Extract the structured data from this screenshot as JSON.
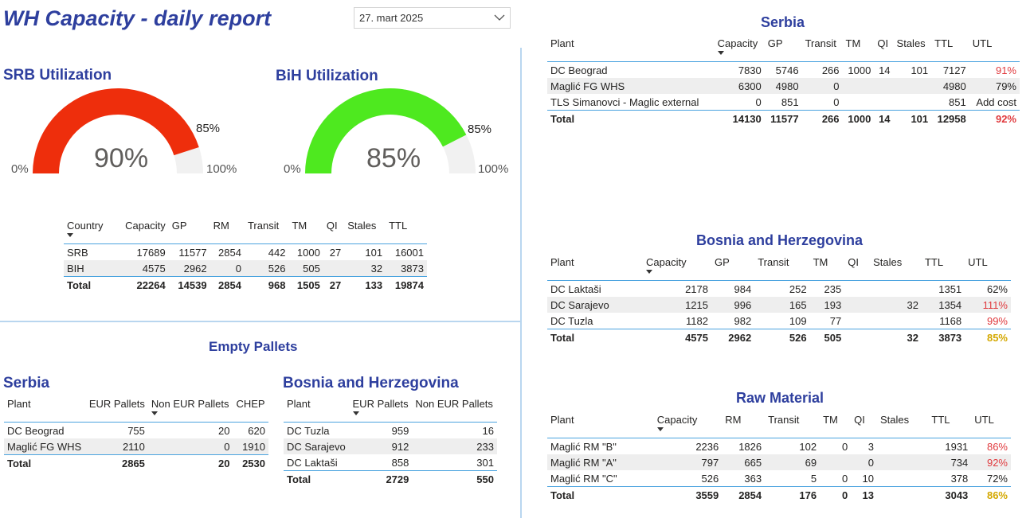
{
  "header": {
    "title": "WH Capacity - daily report",
    "date": "27. mart 2025"
  },
  "gauges": [
    {
      "title": "SRB Utilization",
      "value_label": "90%",
      "value": 0.9,
      "target_label": "85%",
      "target": 0.85,
      "min_label": "0%",
      "max_label": "100%",
      "color": "#ee2e0c"
    },
    {
      "title": "BiH Utilization",
      "value_label": "85%",
      "value": 0.85,
      "target_label": "85%",
      "target": 0.85,
      "min_label": "0%",
      "max_label": "100%",
      "color": "#4ee91f"
    }
  ],
  "country_table": {
    "columns": [
      "Country",
      "Capacity",
      "GP",
      "RM",
      "Transit",
      "TM",
      "QI",
      "Stales",
      "TTL"
    ],
    "rows": [
      [
        "SRB",
        "17689",
        "11577",
        "2854",
        "442",
        "1000",
        "27",
        "101",
        "16001"
      ],
      [
        "BIH",
        "4575",
        "2962",
        "0",
        "526",
        "505",
        "",
        "32",
        "3873"
      ]
    ],
    "total": [
      "Total",
      "22264",
      "14539",
      "2854",
      "968",
      "1505",
      "27",
      "133",
      "19874"
    ]
  },
  "empty_pallets": {
    "title": "Empty Pallets",
    "serbia": {
      "title": "Serbia",
      "columns": [
        "Plant",
        "EUR Pallets",
        "Non EUR Pallets",
        "CHEP"
      ],
      "rows": [
        [
          "DC Beograd",
          "755",
          "20",
          "620"
        ],
        [
          "Maglić FG WHS",
          "2110",
          "0",
          "1910"
        ]
      ],
      "total": [
        "Total",
        "2865",
        "20",
        "2530"
      ]
    },
    "bih": {
      "title": "Bosnia and Herzegovina",
      "columns": [
        "Plant",
        "EUR Pallets",
        "Non EUR Pallets"
      ],
      "rows": [
        [
          "DC Tuzla",
          "959",
          "16"
        ],
        [
          "DC Sarajevo",
          "912",
          "233"
        ],
        [
          "DC Laktaši",
          "858",
          "301"
        ]
      ],
      "total": [
        "Total",
        "2729",
        "550"
      ]
    }
  },
  "serbia_table": {
    "title": "Serbia",
    "columns": [
      "Plant",
      "Capacity",
      "GP",
      "Transit",
      "TM",
      "QI",
      "Stales",
      "TTL",
      "UTL"
    ],
    "rows": [
      [
        "DC Beograd",
        "7830",
        "5746",
        "266",
        "1000",
        "14",
        "101",
        "7127",
        "91%"
      ],
      [
        "Maglić FG WHS",
        "6300",
        "4980",
        "0",
        "",
        "",
        "",
        "4980",
        "79%"
      ],
      [
        "TLS Simanovci - Maglic external",
        "0",
        "851",
        "0",
        "",
        "",
        "",
        "851",
        "Add cost"
      ]
    ],
    "total": [
      "Total",
      "14130",
      "11577",
      "266",
      "1000",
      "14",
      "101",
      "12958",
      "92%"
    ]
  },
  "bih_table": {
    "title": "Bosnia and Herzegovina",
    "columns": [
      "Plant",
      "Capacity",
      "GP",
      "Transit",
      "TM",
      "QI",
      "Stales",
      "TTL",
      "UTL"
    ],
    "rows": [
      [
        "DC Laktaši",
        "2178",
        "984",
        "252",
        "235",
        "",
        "",
        "1351",
        "62%"
      ],
      [
        "DC Sarajevo",
        "1215",
        "996",
        "165",
        "193",
        "",
        "32",
        "1354",
        "111%"
      ],
      [
        "DC Tuzla",
        "1182",
        "982",
        "109",
        "77",
        "",
        "",
        "1168",
        "99%"
      ]
    ],
    "total": [
      "Total",
      "4575",
      "2962",
      "526",
      "505",
      "",
      "32",
      "3873",
      "85%"
    ]
  },
  "raw_table": {
    "title": "Raw Material",
    "columns": [
      "Plant",
      "Capacity",
      "RM",
      "Transit",
      "TM",
      "QI",
      "Stales",
      "TTL",
      "UTL"
    ],
    "rows": [
      [
        "Maglić RM \"B\"",
        "2236",
        "1826",
        "102",
        "0",
        "3",
        "",
        "1931",
        "86%"
      ],
      [
        "Maglić RM \"A\"",
        "797",
        "665",
        "69",
        "",
        "0",
        "",
        "734",
        "92%"
      ],
      [
        "Maglić RM \"C\"",
        "526",
        "363",
        "5",
        "0",
        "10",
        "",
        "378",
        "72%"
      ]
    ],
    "total": [
      "Total",
      "3559",
      "2854",
      "176",
      "0",
      "13",
      "",
      "3043",
      "86%"
    ]
  },
  "colors": {
    "accent_title": "#2e3f9e",
    "divider": "#b9d6ef",
    "red": "#e03a3e",
    "gold": "#d4a800"
  }
}
